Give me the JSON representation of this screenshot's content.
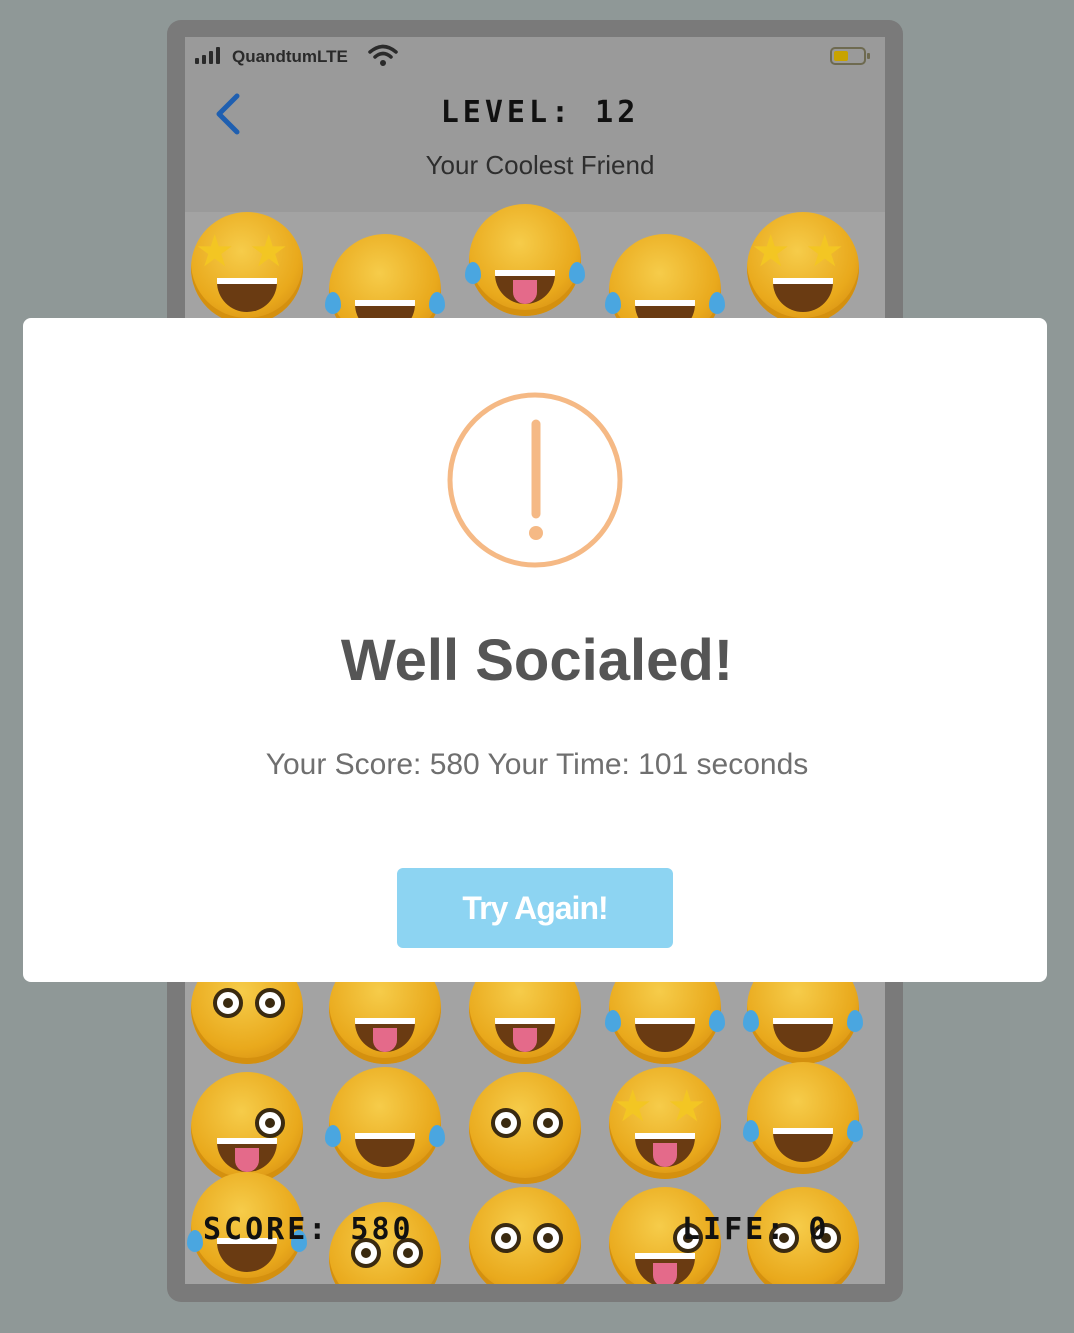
{
  "status_bar": {
    "carrier": "QuandtumLTE",
    "wifi_icon": "wifi-icon",
    "battery_icon": "battery-icon",
    "battery_color": "#c8a300"
  },
  "header": {
    "back_icon": "chevron-left-icon",
    "level_text": "LEVEL: 12",
    "subtitle": "Your Coolest Friend"
  },
  "hud": {
    "score_text": "SCORE: 580",
    "life_text": "LIFE: 0"
  },
  "board": {
    "emoji_icons": [
      "star-struck-emoji-icon",
      "tears-of-joy-emoji-icon",
      "pleading-emoji-icon",
      "winking-tongue-emoji-icon",
      "tongue-out-emoji-icon"
    ]
  },
  "modal": {
    "icon": "exclamation-circle-icon",
    "icon_color": "#f5b985",
    "title": "Well Socialed!",
    "text": "Your Score: 580 Your Time: 101 seconds",
    "button_label": "Try Again!",
    "button_color": "#8dd4f2"
  }
}
